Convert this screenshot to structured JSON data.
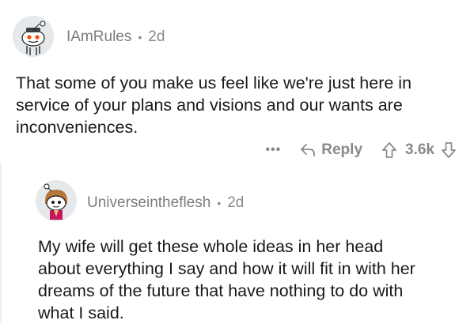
{
  "comment": {
    "username": "IAmRules",
    "separator": "•",
    "time": "2d",
    "body_lines": [
      "That some of  you make us feel like we're just here in",
      "service of your plans and visions and our wants are",
      "inconveniences."
    ],
    "actions": {
      "more": "•••",
      "reply_label": "Reply",
      "score": "3.6k"
    }
  },
  "reply": {
    "username": "Universeintheflesh",
    "separator": "•",
    "time": "2d",
    "body_lines": [
      "My wife will get these whole ideas in her head",
      "about everything I say and how it will fit in with her",
      "dreams of the future that have nothing to do with",
      "what I said."
    ]
  },
  "colors": {
    "meta": "#878a8c",
    "text": "#1a1a1b",
    "avatar_bg": "#e6e9ec"
  },
  "icons": {
    "avatar_1": "snoo-avatar-icon",
    "avatar_2": "snoo-avatar-icon",
    "reply": "reply-arrow-icon",
    "upvote": "upvote-arrow-icon",
    "downvote": "downvote-arrow-icon",
    "more": "more-dots-icon"
  }
}
